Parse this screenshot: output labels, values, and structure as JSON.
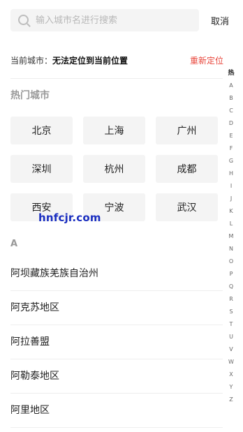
{
  "search": {
    "placeholder": "输入城市名进行搜索",
    "value": ""
  },
  "cancel_label": "取消",
  "current_city": {
    "label": "当前城市：",
    "value": "无法定位到当前位置",
    "relocate_label": "重新定位"
  },
  "hot": {
    "title": "热门城市",
    "cities": [
      "北京",
      "上海",
      "广州",
      "深圳",
      "杭州",
      "成都",
      "西安",
      "宁波",
      "武汉"
    ]
  },
  "watermark": "hnfcjr.com",
  "section": {
    "letter": "A",
    "cities": [
      "阿坝藏族羌族自治州",
      "阿克苏地区",
      "阿拉善盟",
      "阿勒泰地区",
      "阿里地区"
    ]
  },
  "alphabet": [
    "热",
    "A",
    "B",
    "C",
    "D",
    "E",
    "F",
    "G",
    "H",
    "I",
    "J",
    "K",
    "L",
    "M",
    "N",
    "O",
    "P",
    "Q",
    "R",
    "S",
    "T",
    "U",
    "V",
    "W",
    "X",
    "Y",
    "Z"
  ]
}
